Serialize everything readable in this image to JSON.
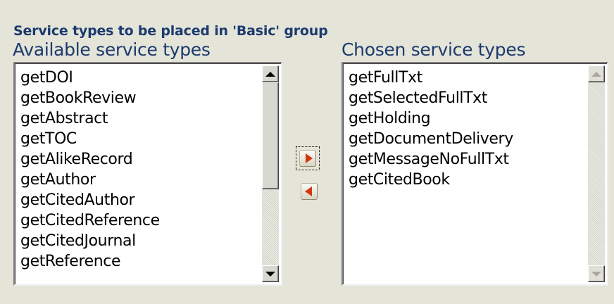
{
  "group_title": "Service types to be placed in 'Basic' group",
  "available": {
    "label": "Available service types",
    "items": [
      "getDOI",
      "getBookReview",
      "getAbstract",
      "getTOC",
      "getAlikeRecord",
      "getAuthor",
      "getCitedAuthor",
      "getCitedReference",
      "getCitedJournal",
      "getReference"
    ]
  },
  "chosen": {
    "label": "Chosen service types",
    "items": [
      "getFullTxt",
      "getSelectedFullTxt",
      "getHolding",
      "getDocumentDelivery",
      "getMessageNoFullTxt",
      "getCitedBook"
    ]
  },
  "buttons": {
    "move_right_icon": "arrow-right-icon",
    "move_left_icon": "arrow-left-icon"
  },
  "colors": {
    "title": "#1c3a6e",
    "background": "#e4e4d8",
    "arrow": "#d4360d"
  }
}
